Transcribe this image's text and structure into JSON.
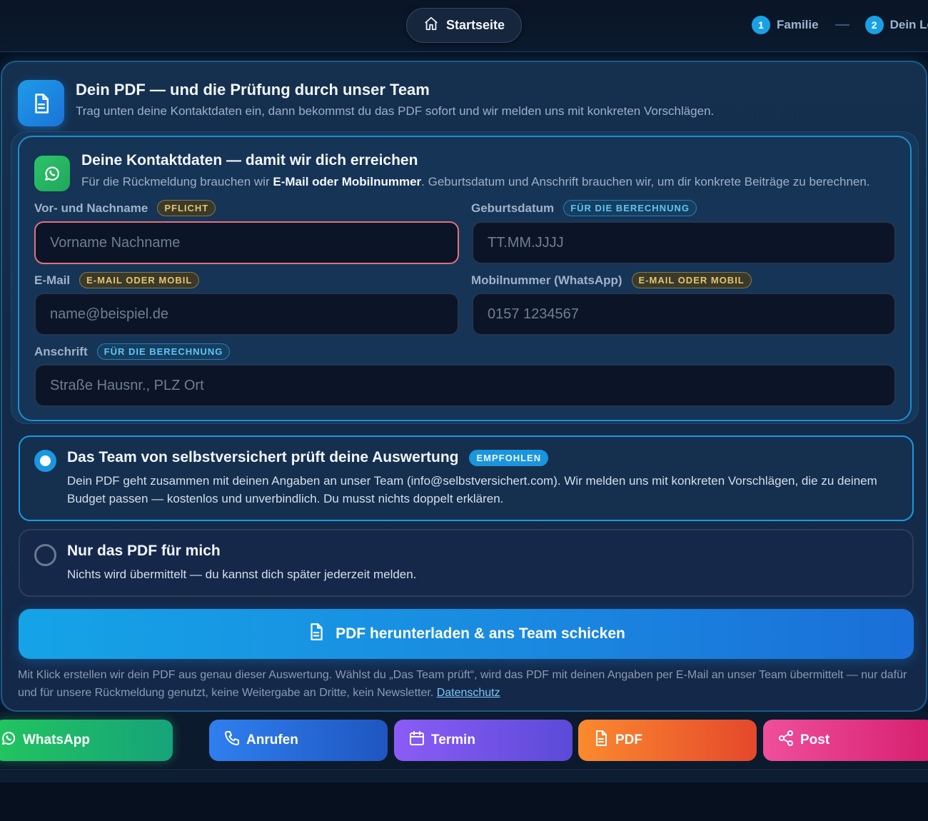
{
  "topbar": {
    "home_label": "Startseite",
    "steps": [
      {
        "num": "1",
        "label": "Familie"
      },
      {
        "num": "2",
        "label": "Dein Le"
      }
    ]
  },
  "header": {
    "title": "Dein PDF — und die Prüfung durch unser Team",
    "subtitle": "Trag unten deine Kontaktdaten ein, dann bekommst du das PDF sofort und wir melden uns mit konkreten Vorschlägen."
  },
  "contact": {
    "title": "Deine Kontaktdaten — damit wir dich erreichen",
    "sub_prefix": "Für die Rückmeldung brauchen wir ",
    "sub_bold": "E-Mail oder Mobilnummer",
    "sub_suffix": ". Geburtsdatum und Anschrift brauchen wir, um dir konkrete Beiträge zu berechnen.",
    "fields": {
      "name": {
        "label": "Vor- und Nachname",
        "badge": "PFLICHT",
        "placeholder": "Vorname Nachname"
      },
      "birth": {
        "label": "Geburtsdatum",
        "badge": "FÜR DIE BERECHNUNG",
        "placeholder": "TT.MM.JJJJ"
      },
      "email": {
        "label": "E-Mail",
        "badge": "E-MAIL ODER MOBIL",
        "placeholder": "name@beispiel.de"
      },
      "mobile": {
        "label": "Mobilnummer (WhatsApp)",
        "badge": "E-MAIL ODER MOBIL",
        "placeholder": "0157 1234567"
      },
      "address": {
        "label": "Anschrift",
        "badge": "FÜR DIE BERECHNUNG",
        "placeholder": "Straße Hausnr., PLZ Ort"
      }
    }
  },
  "options": {
    "team": {
      "title": "Das Team von selbstversichert prüft deine Auswertung",
      "badge": "EMPFOHLEN",
      "text": "Dein PDF geht zusammen mit deinen Angaben an unser Team (info@selbstversichert.com). Wir melden uns mit konkreten Vorschlägen, die zu deinem Budget passen — kostenlos und unverbindlich. Du musst nichts doppelt erklären.",
      "selected": true
    },
    "pdf_only": {
      "title": "Nur das PDF für mich",
      "text": "Nichts wird übermittelt — du kannst dich später jederzeit melden.",
      "selected": false
    }
  },
  "cta": {
    "label": "PDF herunterladen & ans Team schicken"
  },
  "disclaimer": {
    "text": "Mit Klick erstellen wir dein PDF aus genau dieser Auswertung. Wählst du „Das Team prüft“, wird das PDF mit deinen Angaben per E-Mail an unser Team übermittelt — nur dafür und für unsere Rückmeldung genutzt, keine Weitergabe an Dritte, kein Newsletter. ",
    "link": "Datenschutz"
  },
  "dock": [
    {
      "label": "WhatsApp",
      "icon": "whatsapp-icon"
    },
    {
      "label": "Anrufen",
      "icon": "phone-icon"
    },
    {
      "label": "Termin",
      "icon": "calendar-icon"
    },
    {
      "label": "PDF",
      "icon": "document-icon"
    },
    {
      "label": "Post",
      "icon": "share-icon"
    }
  ]
}
